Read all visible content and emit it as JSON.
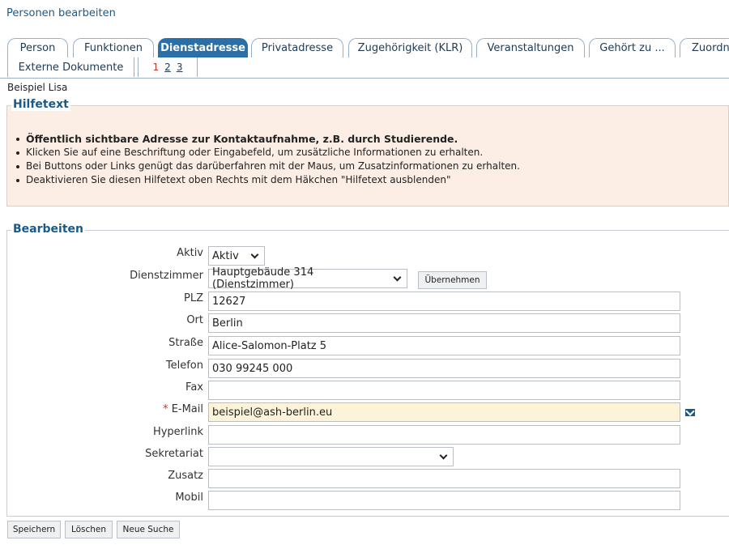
{
  "page_title": "Personen bearbeiten",
  "tabs": [
    {
      "label": "Person"
    },
    {
      "label": "Funktionen"
    },
    {
      "label": "Dienstadresse"
    },
    {
      "label": "Privatadresse"
    },
    {
      "label": "Zugehörigkeit (KLR)"
    },
    {
      "label": "Veranstaltungen"
    },
    {
      "label": "Gehört zu ..."
    },
    {
      "label": "Zuordn"
    },
    {
      "label": "Externe Dokumente"
    }
  ],
  "pager": {
    "current": "1",
    "pages": [
      "2",
      "3"
    ]
  },
  "person_name": "Beispiel  Lisa",
  "help": {
    "legend": "Hilfetext",
    "items": [
      "Öffentlich sichtbare Adresse zur Kontaktaufnahme, z.B. durch Studierende.",
      "Klicken Sie auf eine Beschriftung oder Eingabefeld, um zusätzliche Informationen zu erhalten.",
      "Bei Buttons oder Links genügt das darüberfahren mit der Maus, um Zusatzinformationen zu erhalten.",
      "Deaktivieren Sie diesen Hilfetext oben Rechts mit dem Häkchen \"Hilfetext ausblenden\""
    ]
  },
  "form": {
    "legend": "Bearbeiten",
    "aktiv": {
      "label": "Aktiv",
      "value": "Aktiv"
    },
    "dienstzimmer": {
      "label": "Dienstzimmer",
      "value": "Hauptgebäude 314 (Dienstzimmer)",
      "button": "Übernehmen"
    },
    "plz": {
      "label": "PLZ",
      "value": "12627"
    },
    "ort": {
      "label": "Ort",
      "value": "Berlin"
    },
    "strasse": {
      "label": "Straße",
      "value": "Alice-Salomon-Platz 5"
    },
    "telefon": {
      "label": "Telefon",
      "value": "030 99245 000"
    },
    "fax": {
      "label": "Fax",
      "value": ""
    },
    "email": {
      "required_mark": "*",
      "label": "E-Mail",
      "value": "beispiel@ash-berlin.eu"
    },
    "hyperlink": {
      "label": "Hyperlink",
      "value": ""
    },
    "sekretariat": {
      "label": "Sekretariat",
      "value": ""
    },
    "zusatz": {
      "label": "Zusatz",
      "value": ""
    },
    "mobil": {
      "label": "Mobil",
      "value": ""
    }
  },
  "actions": {
    "save": "Speichern",
    "delete": "Löschen",
    "new_search": "Neue Suche"
  },
  "colors": {
    "accent": "#2a6fa8",
    "help_bg": "#fdeee5",
    "email_bg": "#fdf3d8",
    "required": "#c0392b"
  }
}
